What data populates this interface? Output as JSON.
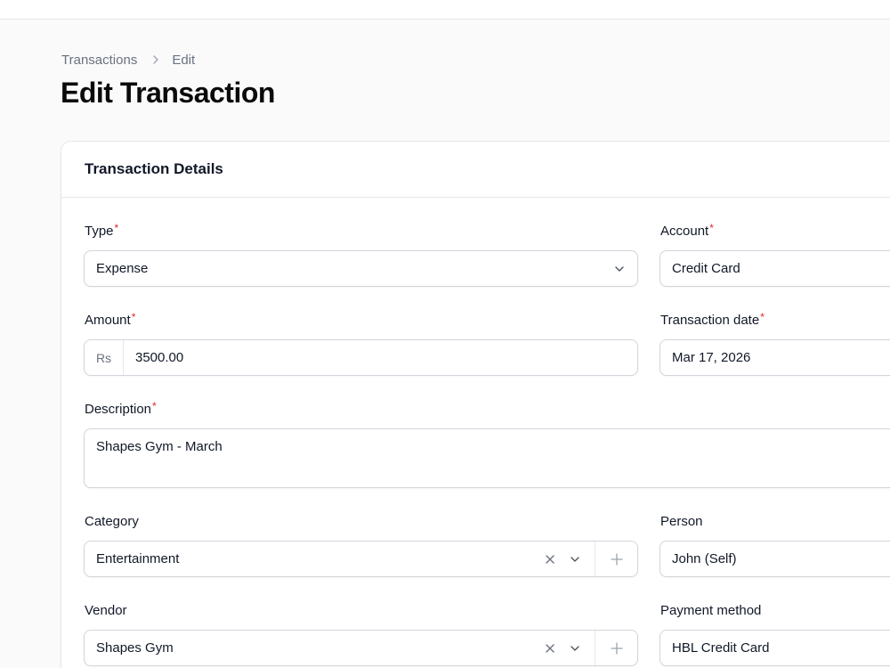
{
  "breadcrumb": {
    "parent": "Transactions",
    "current": "Edit"
  },
  "page": {
    "title": "Edit Transaction"
  },
  "card": {
    "title": "Transaction Details"
  },
  "form": {
    "type": {
      "label": "Type",
      "required_mark": "*",
      "value": "Expense"
    },
    "account": {
      "label": "Account",
      "required_mark": "*",
      "value": "Credit Card"
    },
    "amount": {
      "label": "Amount",
      "required_mark": "*",
      "prefix": "Rs",
      "value": "3500.00"
    },
    "transaction_date": {
      "label": "Transaction date",
      "required_mark": "*",
      "value": "Mar 17, 2026"
    },
    "description": {
      "label": "Description",
      "required_mark": "*",
      "value": "Shapes Gym - March"
    },
    "category": {
      "label": "Category",
      "value": "Entertainment"
    },
    "person": {
      "label": "Person",
      "value": "John (Self)"
    },
    "vendor": {
      "label": "Vendor",
      "value": "Shapes Gym"
    },
    "payment_method": {
      "label": "Payment method",
      "value": "HBL Credit Card"
    }
  },
  "icons": {
    "breadcrumb_separator": "chevron-right-icon",
    "select": "chevron-down-icon",
    "clear": "x-icon",
    "add": "plus-icon"
  },
  "colors": {
    "required": "#dc2626",
    "muted_text": "#6b7280",
    "border": "#d1d5db"
  }
}
